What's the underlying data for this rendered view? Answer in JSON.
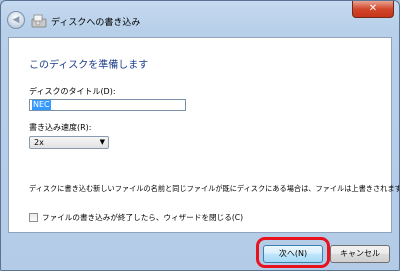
{
  "window": {
    "title": "ディスクへの書き込み",
    "close_glyph": "✕",
    "back_glyph": "◀"
  },
  "content": {
    "heading": "このディスクを準備します",
    "disc_title_label": "ディスクのタイトル(D):",
    "disc_title_value": "NEC",
    "speed_label": "書き込み速度(R):",
    "speed_value": "2x",
    "note": "ディスクに書き込む新しいファイルの名前と同じファイルが既にディスクにある場合は、ファイルは上書きされます。",
    "close_wizard_label": "ファイルの書き込みが終了したら、ウィザードを閉じる(C)",
    "close_wizard_checked": false
  },
  "buttons": {
    "next": "次へ(N)",
    "cancel": "キャンセル"
  },
  "colors": {
    "heading": "#1c3e8c",
    "highlight": "#e8121e",
    "selection": "#3399ff"
  }
}
